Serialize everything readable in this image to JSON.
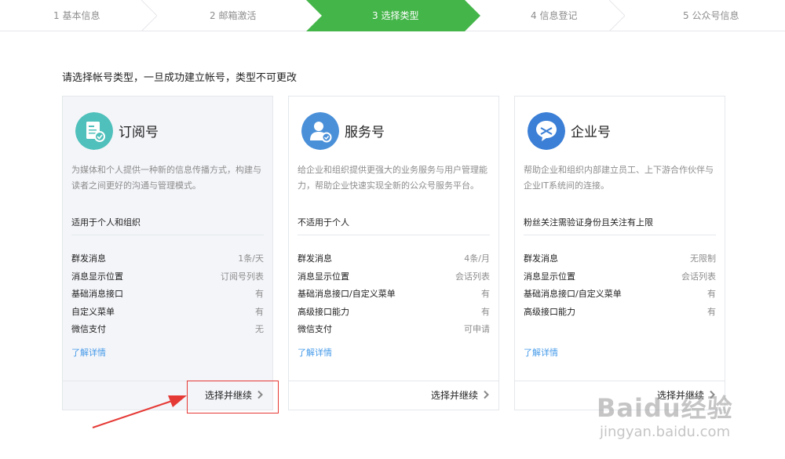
{
  "steps": [
    {
      "label": "1 基本信息"
    },
    {
      "label": "2 邮箱激活"
    },
    {
      "label": "3 选择类型"
    },
    {
      "label": "4 信息登记"
    },
    {
      "label": "5 公众号信息"
    }
  ],
  "active_step": 3,
  "intro": "请选择帐号类型，一旦成功建立帐号，类型不可更改",
  "cards": [
    {
      "title": "订阅号",
      "icon": "subscription-icon",
      "icon_color": "#4fc0bb",
      "desc": "为媒体和个人提供一种新的信息传播方式，构建与读者之间更好的沟通与管理模式。",
      "suit": "适用于个人和组织",
      "rows": [
        {
          "k": "群发消息",
          "v": "1条/天"
        },
        {
          "k": "消息显示位置",
          "v": "订阅号列表"
        },
        {
          "k": "基础消息接口",
          "v": "有"
        },
        {
          "k": "自定义菜单",
          "v": "有"
        },
        {
          "k": "微信支付",
          "v": "无"
        }
      ],
      "more": "了解详情",
      "cta": "选择并继续"
    },
    {
      "title": "服务号",
      "icon": "service-icon",
      "icon_color": "#4a90d9",
      "desc": "给企业和组织提供更强大的业务服务与用户管理能力，帮助企业快速实现全新的公众号服务平台。",
      "suit": "不适用于个人",
      "rows": [
        {
          "k": "群发消息",
          "v": "4条/月"
        },
        {
          "k": "消息显示位置",
          "v": "会话列表"
        },
        {
          "k": "基础消息接口/自定义菜单",
          "v": "有"
        },
        {
          "k": "高级接口能力",
          "v": "有"
        },
        {
          "k": "微信支付",
          "v": "可申请"
        }
      ],
      "more": "了解详情",
      "cta": "选择并继续"
    },
    {
      "title": "企业号",
      "icon": "enterprise-icon",
      "icon_color": "#3b7fd6",
      "desc": "帮助企业和组织内部建立员工、上下游合作伙伴与企业IT系统间的连接。",
      "suit": "粉丝关注需验证身份且关注有上限",
      "rows": [
        {
          "k": "群发消息",
          "v": "无限制"
        },
        {
          "k": "消息显示位置",
          "v": "会话列表"
        },
        {
          "k": "基础消息接口/自定义菜单",
          "v": "有"
        },
        {
          "k": "高级接口能力",
          "v": "有"
        }
      ],
      "more": "了解详情",
      "cta": "选择并继续"
    }
  ],
  "colors": {
    "accent": "#44b549",
    "link": "#459ae9",
    "highlight": "#e53935"
  },
  "watermark": {
    "brand": "Baidu经验",
    "url": "jingyan.baidu.com"
  }
}
